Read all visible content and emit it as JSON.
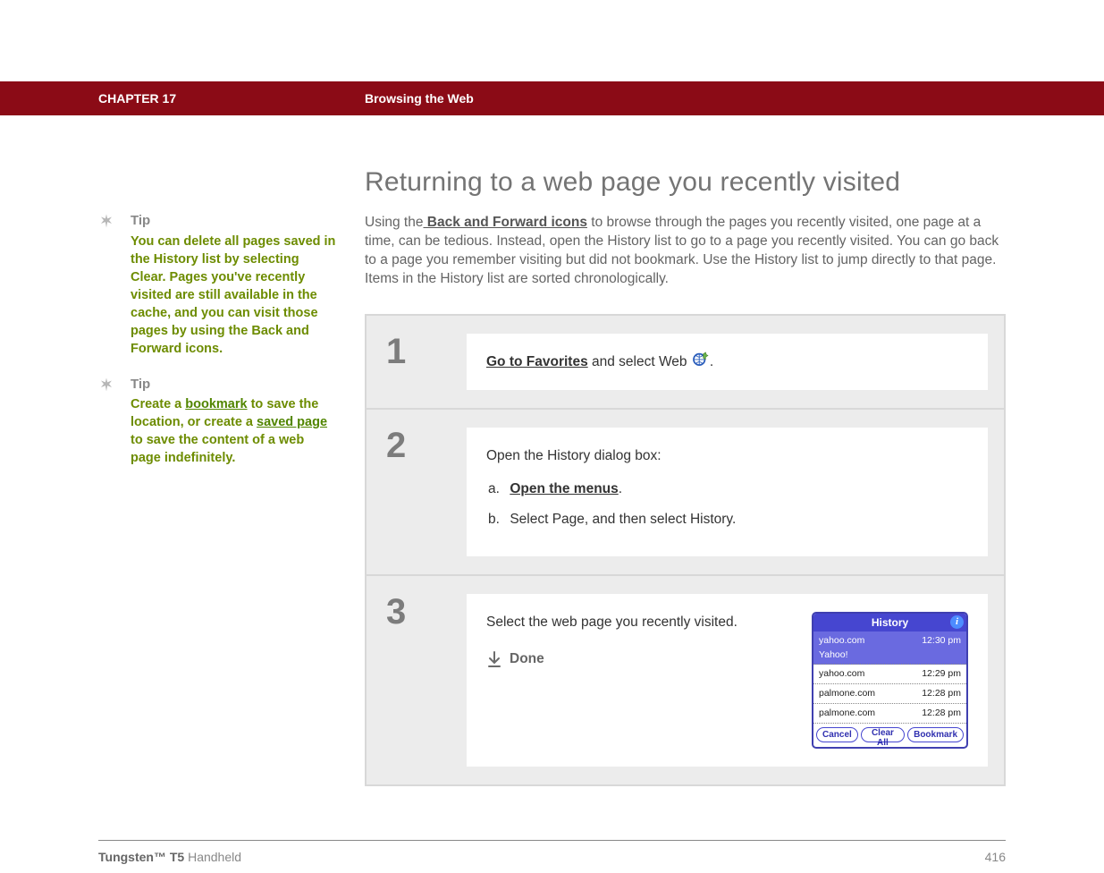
{
  "header": {
    "chapter": "CHAPTER 17",
    "section": "Browsing the Web"
  },
  "sidebar": {
    "tip_label": "Tip",
    "tip1": {
      "text": "You can delete all pages saved in the History list by selecting Clear. Pages you've recently visited are still available in the cache, and you can visit those pages by using the Back and Forward icons."
    },
    "tip2": {
      "prefix": "Create a ",
      "link1": "bookmark",
      "mid1": " to save the location, or create a ",
      "link2": "saved page",
      "suffix": " to save the content of a web page indefinitely."
    }
  },
  "main": {
    "title": "Returning to a web page you recently visited",
    "intro_prefix": "Using the",
    "intro_link": " Back and Forward icons",
    "intro_rest": " to browse through the pages you recently visited, one page at a time, can be tedious. Instead, open the History list to go to a page you recently visited. You can go back to a page you remember visiting but did not bookmark. Use the History list to jump directly to that page. Items in the History list are sorted chronologically."
  },
  "steps": {
    "s1": {
      "num": "1",
      "link": "Go to Favorites",
      "rest": " and select Web ",
      "period": "."
    },
    "s2": {
      "num": "2",
      "lead": "Open the History dialog box:",
      "a_link": "Open the menus",
      "a_suffix": ".",
      "b": "Select Page, and then select History."
    },
    "s3": {
      "num": "3",
      "text": "Select the web page you recently visited.",
      "done": "Done"
    }
  },
  "history_dialog": {
    "title": "History",
    "rows": [
      {
        "name": "yahoo.com\nYahoo!",
        "time": "12:30 pm",
        "selected": true
      },
      {
        "name": "yahoo.com",
        "time": "12:29 pm",
        "selected": false
      },
      {
        "name": "palmone.com",
        "time": "12:28 pm",
        "selected": false
      },
      {
        "name": "palmone.com",
        "time": "12:28 pm",
        "selected": false
      }
    ],
    "buttons": {
      "cancel": "Cancel",
      "clear": "Clear All",
      "bookmark": "Bookmark"
    }
  },
  "footer": {
    "product_bold": "Tungsten™ T5",
    "product_rest": " Handheld",
    "page": "416"
  }
}
